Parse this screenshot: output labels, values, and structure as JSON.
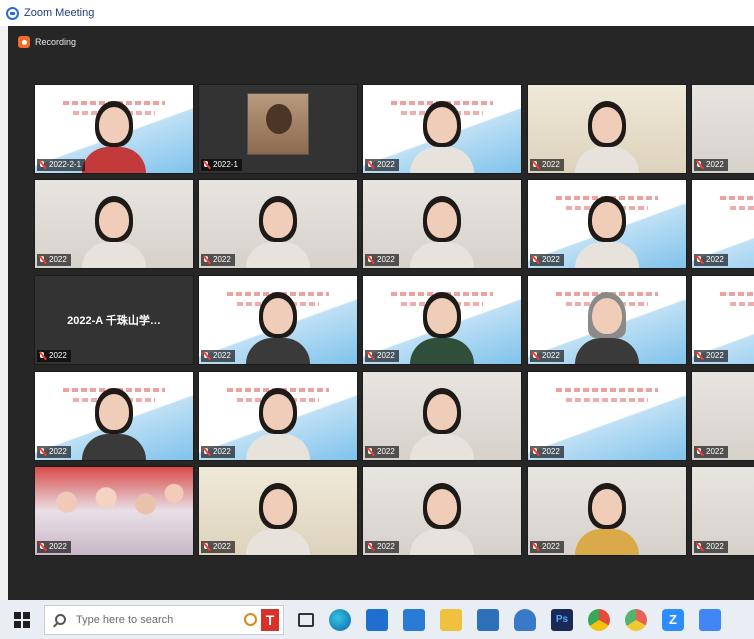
{
  "window": {
    "title": "Zoom Meeting"
  },
  "meeting": {
    "recording_label": "Recording"
  },
  "tiles": [
    {
      "kind": "slide",
      "person": "red",
      "label": "2022-2-1"
    },
    {
      "kind": "photo",
      "person": "none",
      "label": "2022-1"
    },
    {
      "kind": "slide",
      "person": "light",
      "label": "2022"
    },
    {
      "kind": "warm",
      "person": "light",
      "label": "2022"
    },
    {
      "kind": "room",
      "person": "none",
      "label": "2022"
    },
    {
      "kind": "room",
      "person": "light",
      "label": "2022"
    },
    {
      "kind": "room",
      "person": "light",
      "label": "2022"
    },
    {
      "kind": "room",
      "person": "light",
      "label": "2022"
    },
    {
      "kind": "slide",
      "person": "light",
      "label": "2022"
    },
    {
      "kind": "slide",
      "person": "none",
      "label": "2022"
    },
    {
      "kind": "dark",
      "person": "none",
      "label": "2022",
      "name_text": "2022-A 千珠山学…"
    },
    {
      "kind": "slide",
      "person": "dark",
      "label": "2022"
    },
    {
      "kind": "slide",
      "person": "green",
      "label": "2022"
    },
    {
      "kind": "slide",
      "person": "cap",
      "label": "2022"
    },
    {
      "kind": "slide",
      "person": "none",
      "label": "2022"
    },
    {
      "kind": "slide",
      "person": "dark",
      "label": "2022"
    },
    {
      "kind": "slide",
      "person": "light",
      "label": "2022"
    },
    {
      "kind": "room",
      "person": "light",
      "label": "2022"
    },
    {
      "kind": "slide",
      "person": "none",
      "label": "2022"
    },
    {
      "kind": "room",
      "person": "none",
      "label": "2022"
    },
    {
      "kind": "crowd",
      "person": "none",
      "label": "2022"
    },
    {
      "kind": "warm",
      "person": "light",
      "label": "2022"
    },
    {
      "kind": "room",
      "person": "light",
      "label": "2022"
    },
    {
      "kind": "room",
      "person": "tan",
      "label": "2022"
    },
    {
      "kind": "room",
      "person": "none",
      "label": "2022"
    }
  ],
  "taskbar": {
    "search_placeholder": "Type here to search",
    "ps_label": "Ps",
    "zoom_label": "Z"
  },
  "colors": {
    "meeting_bg": "#262626",
    "recording_accent": "#f06a2c",
    "taskbar_bg": "#e9eef5",
    "zoom_blue": "#2d8cff"
  }
}
